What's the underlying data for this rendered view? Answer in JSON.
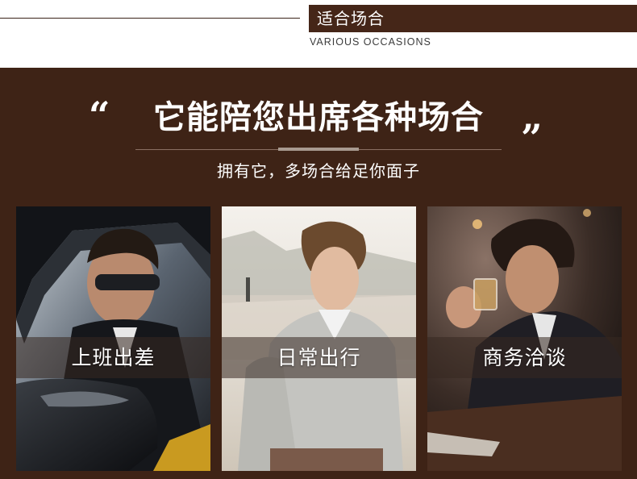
{
  "header": {
    "title": "适合场合",
    "subtitle": "VARIOUS OCCASIONS"
  },
  "hero": {
    "quote_open": "“",
    "headline": "它能陪您出席各种场合",
    "quote_close": "”",
    "tagline": "拥有它，多场合给足你面子"
  },
  "cards": [
    {
      "label": "上班出差"
    },
    {
      "label": "日常出行"
    },
    {
      "label": "商务洽谈"
    }
  ],
  "colors": {
    "panel_background": "#3e2316",
    "title_box": "#452618",
    "text_light": "#ffffff"
  }
}
